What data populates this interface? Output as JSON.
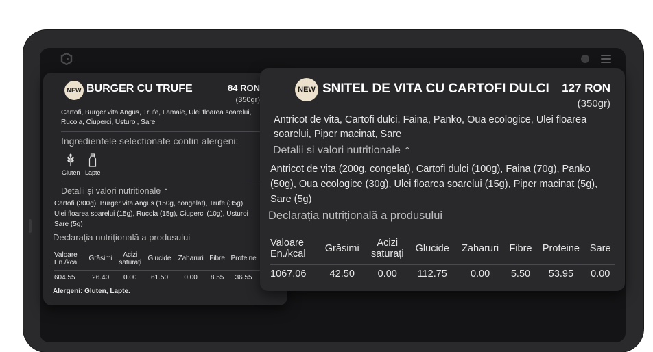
{
  "card_small": {
    "badge": "NEW",
    "title": "BURGER CU TRUFE",
    "price": "84 RON",
    "weight": "(350gr)",
    "ingredients_line1": "Cartofi, Burger vita Angus, Trufe, Lamaie, Ulei floarea soarelui,",
    "ingredients_line2": "Rucola, Ciuperci, Usturoi, Sare",
    "allergen_heading": "Ingredientele selectionate contin alergeni:",
    "allergens": [
      {
        "label": "Gluten",
        "icon": "wheat-icon"
      },
      {
        "label": "Lapte",
        "icon": "milk-bottle-icon"
      }
    ],
    "details_label": "Detalii și valori nutritionale",
    "details_line1": "Cartofi (300g), Burger vita Angus (150g, congelat), Trufe (35g),",
    "details_line2": "Ulei floarea soarelui (15g), Rucola (15g), Ciuperci (10g), Usturoi",
    "details_line3": "Sare (5g)",
    "declaration": "Declarația nutrițională a produsului",
    "table": {
      "headers": [
        "Valoare\nEn./kcal",
        "Grăsimi",
        "Acizi\nsaturați",
        "Glucide",
        "Zaharuri",
        "Fibre",
        "Proteine"
      ],
      "values": [
        "604.55",
        "26.40",
        "0.00",
        "61.50",
        "0.00",
        "8.55",
        "36.55"
      ]
    },
    "allergens_footer": "Alergeni: Gluten, Lapte."
  },
  "card_large": {
    "badge": "NEW",
    "title": "SNITEL DE VITA CU CARTOFI DULCI",
    "price": "127 RON",
    "weight": "(350gr)",
    "ingredients_line1": "Antricot de vita, Cartofi dulci, Faina, Panko, Oua ecologice, Ulei floarea",
    "ingredients_line2": "soarelui, Piper macinat, Sare",
    "details_label": "Detalii si valori nutritionale",
    "details_line1": "Antricot de vita (200g, congelat), Cartofi dulci (100g), Faina (70g), Panko",
    "details_line2": "(50g), Oua ecologice (30g), Ulei floarea soarelui (15g), Piper macinat (5g),",
    "details_line3": "Sare (5g)",
    "declaration": "Declarația nutrițională a produsului",
    "table": {
      "headers": [
        "Valoare\nEn./kcal",
        "Grăsimi",
        "Acizi\nsaturați",
        "Glucide",
        "Zaharuri",
        "Fibre",
        "Proteine",
        "Sare"
      ],
      "values": [
        "1067.06",
        "42.50",
        "0.00",
        "112.75",
        "0.00",
        "5.50",
        "53.95",
        "0.00"
      ]
    }
  },
  "colors": {
    "badge_bg": "#ece1cc",
    "card_bg": "#262629",
    "screen_bg": "#141416"
  }
}
